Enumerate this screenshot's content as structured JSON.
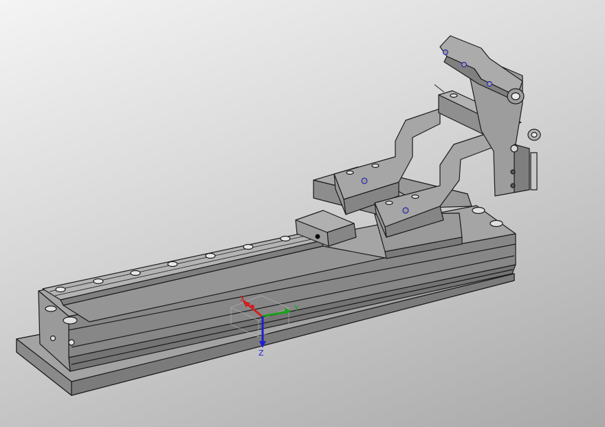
{
  "viewport": {
    "background_top": "#f4f4f4",
    "background_bottom": "#a9a9a9"
  },
  "model": {
    "body_color": "#8e8e8e",
    "face_light": "#a8a8a8",
    "face_dark": "#6f6f6f",
    "edge_color": "#1a1a1a",
    "hole_accent": "#2a2ab0"
  },
  "triad": {
    "x_color": "#d21e1e",
    "y_color": "#1ea01e",
    "z_color": "#1e1ed2",
    "x_label": "X",
    "y_label": "Y",
    "z_label": "Z"
  }
}
